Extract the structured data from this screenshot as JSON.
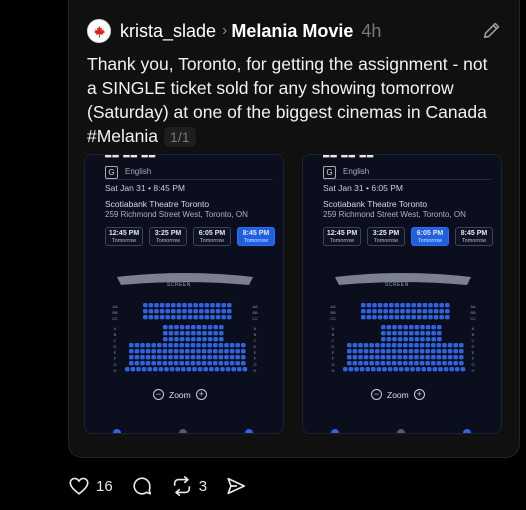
{
  "post": {
    "username": "krista_slade",
    "community": "Melania Movie",
    "time": "4h",
    "text": "Thank you, Toronto, for getting the assignment - not a SINGLE ticket sold for any showing tomorrow (Saturday) at one of the biggest cinemas in Canada #Melania",
    "image_counter": "1/1"
  },
  "images": [
    {
      "rating": "G",
      "language": "English",
      "date": "Sat Jan 31  •  8:45 PM",
      "theatre": "Scotiabank Theatre Toronto",
      "address": "259 Richmond Street West, Toronto, ON",
      "showtimes": [
        {
          "time": "12:45 PM",
          "day": "Tomorrow"
        },
        {
          "time": "3:25 PM",
          "day": "Tomorrow"
        },
        {
          "time": "6:05 PM",
          "day": "Tomorrow"
        },
        {
          "time": "8:45 PM",
          "day": "Tomorrow"
        }
      ],
      "selected_showtime": "8:45 PM",
      "screen_label": "SCREEN",
      "zoom_label": "Zoom"
    },
    {
      "rating": "G",
      "language": "English",
      "date": "Sat Jan 31  •  6:05 PM",
      "theatre": "Scotiabank Theatre Toronto",
      "address": "259 Richmond Street West, Toronto, ON",
      "showtimes": [
        {
          "time": "12:45 PM",
          "day": "Tomorrow"
        },
        {
          "time": "3:25 PM",
          "day": "Tomorrow"
        },
        {
          "time": "6:05 PM",
          "day": "Tomorrow"
        },
        {
          "time": "8:45 PM",
          "day": "Tomorrow"
        }
      ],
      "selected_showtime": "6:05 PM",
      "screen_label": "SCREEN",
      "zoom_label": "Zoom"
    }
  ],
  "actions": {
    "likes": "16",
    "reposts": "3"
  },
  "colors": {
    "seat_available": "#2f63e0",
    "selected_time": "#1f5fe0",
    "background": "#000000",
    "card": "#101010"
  },
  "icons": [
    "canada-flag-avatar",
    "chevron-right-icon",
    "edit-icon",
    "heart-icon",
    "comment-icon",
    "repost-icon",
    "share-icon"
  ]
}
